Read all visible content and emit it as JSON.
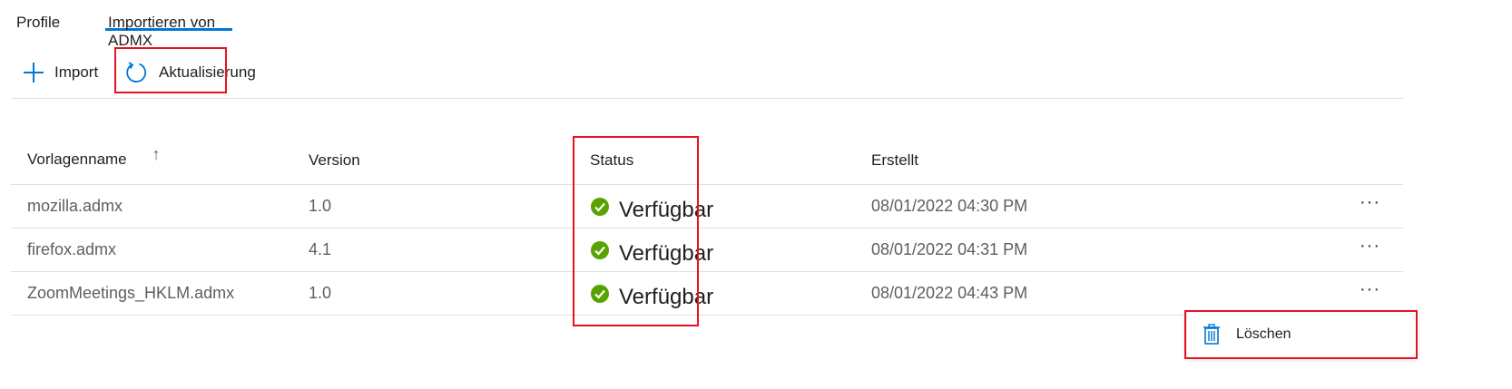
{
  "tabs": [
    {
      "label": "Profile",
      "active": false
    },
    {
      "label": "Importieren von ADMX",
      "active": true
    }
  ],
  "toolbar": {
    "import_label": "Import",
    "refresh_label": "Aktualisierung"
  },
  "table": {
    "columns": {
      "name": "Vorlagenname",
      "version": "Version",
      "status": "Status",
      "created": "Erstellt"
    },
    "sort_icon": "↑",
    "rows": [
      {
        "name": "mozilla.admx",
        "version": "1.0",
        "status": "Verfügbar",
        "created": "08/01/2022 04:30 PM",
        "more": "···"
      },
      {
        "name": "firefox.admx",
        "version": "4.1",
        "status": "Verfügbar",
        "created": "08/01/2022 04:31 PM",
        "more": "···"
      },
      {
        "name": "ZoomMeetings_HKLM.admx",
        "version": "1.0",
        "status": "Verfügbar",
        "created": "08/01/2022 04:43 PM",
        "more": "···"
      }
    ]
  },
  "context_menu": {
    "delete_label": "Löschen"
  },
  "colors": {
    "accent": "#0078d4",
    "success": "#57a300",
    "highlight": "#e81123"
  }
}
